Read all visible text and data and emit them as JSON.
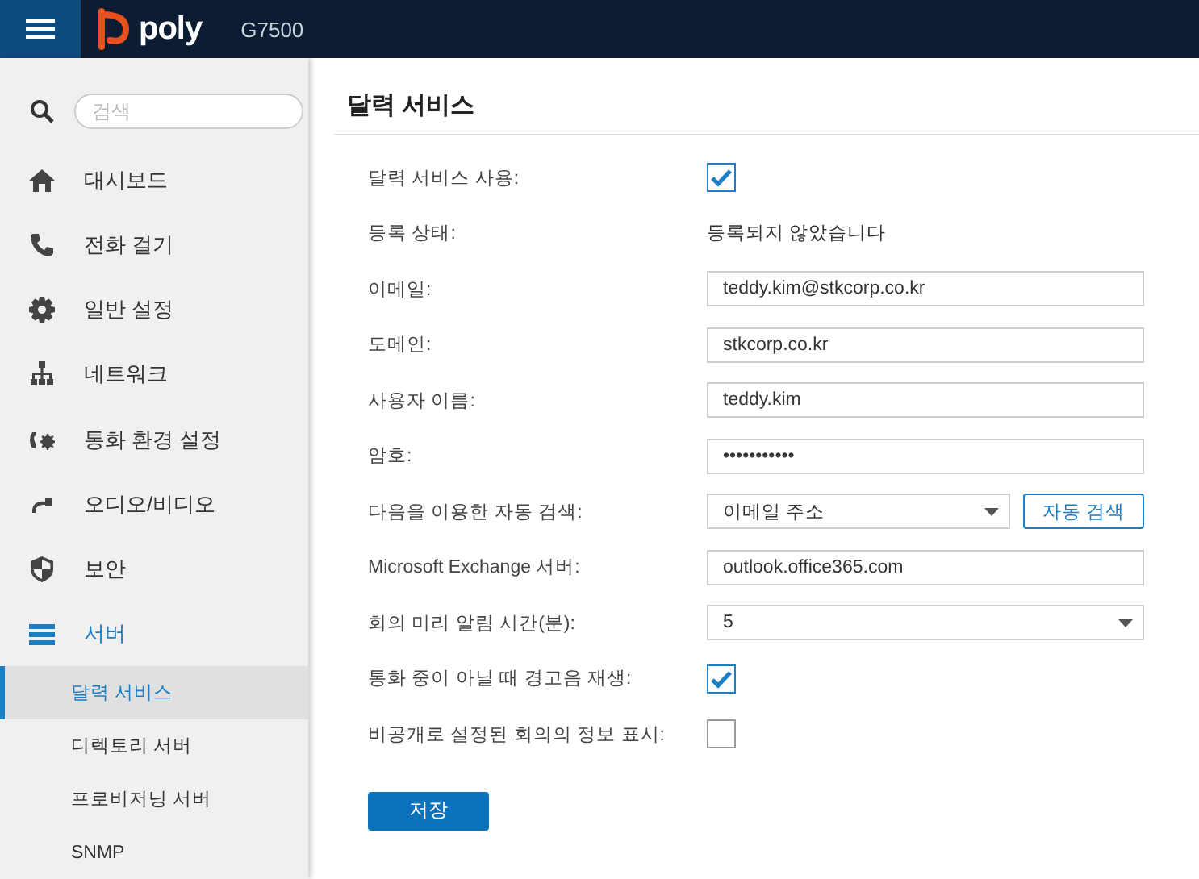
{
  "header": {
    "logo": "poly",
    "model": "G7500"
  },
  "sidebar": {
    "search": {
      "placeholder": "검색"
    },
    "items": [
      {
        "label": "대시보드",
        "selected": false
      },
      {
        "label": "전화 걸기",
        "selected": false
      },
      {
        "label": "일반 설정",
        "selected": false
      },
      {
        "label": "네트워크",
        "selected": false
      },
      {
        "label": "통화 환경 설정",
        "selected": false
      },
      {
        "label": "오디오/비디오",
        "selected": false
      },
      {
        "label": "보안",
        "selected": false
      },
      {
        "label": "서버",
        "selected": true,
        "children": [
          {
            "label": "달력 서비스",
            "selected": true
          },
          {
            "label": "디렉토리 서버",
            "selected": false
          },
          {
            "label": "프로비저닝 서버",
            "selected": false
          },
          {
            "label": "SNMP",
            "selected": false
          }
        ]
      }
    ]
  },
  "form": {
    "title": "달력 서비스",
    "rows": [
      {
        "kind": "checkbox",
        "label": "달력 서비스 사용:",
        "checked": true
      },
      {
        "kind": "text",
        "label": "등록 상태:",
        "value": "등록되지 않았습니다"
      },
      {
        "kind": "input",
        "label": "이메일:",
        "value": "teddy.kim@stkcorp.co.kr"
      },
      {
        "kind": "input",
        "label": "도메인:",
        "value": "stkcorp.co.kr"
      },
      {
        "kind": "input",
        "label": "사용자 이름:",
        "value": "teddy.kim"
      },
      {
        "kind": "input",
        "label": "암호:",
        "value": "•••••••••••"
      },
      {
        "kind": "select",
        "label": "다음을 이용한 자동 검색:",
        "value": "이메일 주소",
        "button": "자동 검색"
      },
      {
        "kind": "input",
        "label": "Microsoft Exchange 서버:",
        "value": "outlook.office365.com"
      },
      {
        "kind": "select",
        "label": "회의 미리 알림 시간(분):",
        "value": "5"
      },
      {
        "kind": "checkbox",
        "label": "통화 중이 아닐 때 경고음 재생:",
        "checked": true
      },
      {
        "kind": "checkbox",
        "label": "비공개로 설정된 회의의 정보 표시:",
        "checked": false
      }
    ],
    "save": "저장"
  }
}
